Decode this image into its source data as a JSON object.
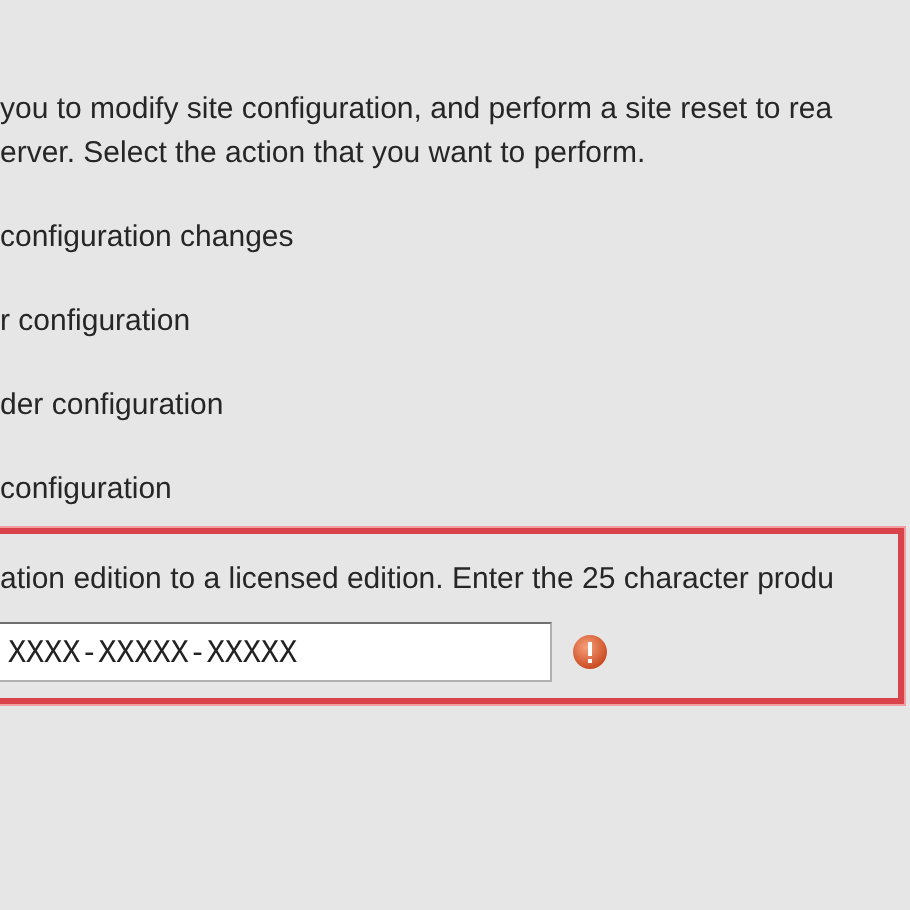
{
  "description": [
    "you to modify site configuration, and perform a site reset to rea",
    "erver.  Select the action that you want to perform."
  ],
  "options": [
    "configuration changes",
    "r configuration",
    "der configuration",
    "configuration"
  ],
  "upgrade": {
    "instruction": "ation edition to a licensed edition. Enter the 25 character produ",
    "product_key": "XXXX-XXXXX-XXXXX",
    "error": true
  }
}
